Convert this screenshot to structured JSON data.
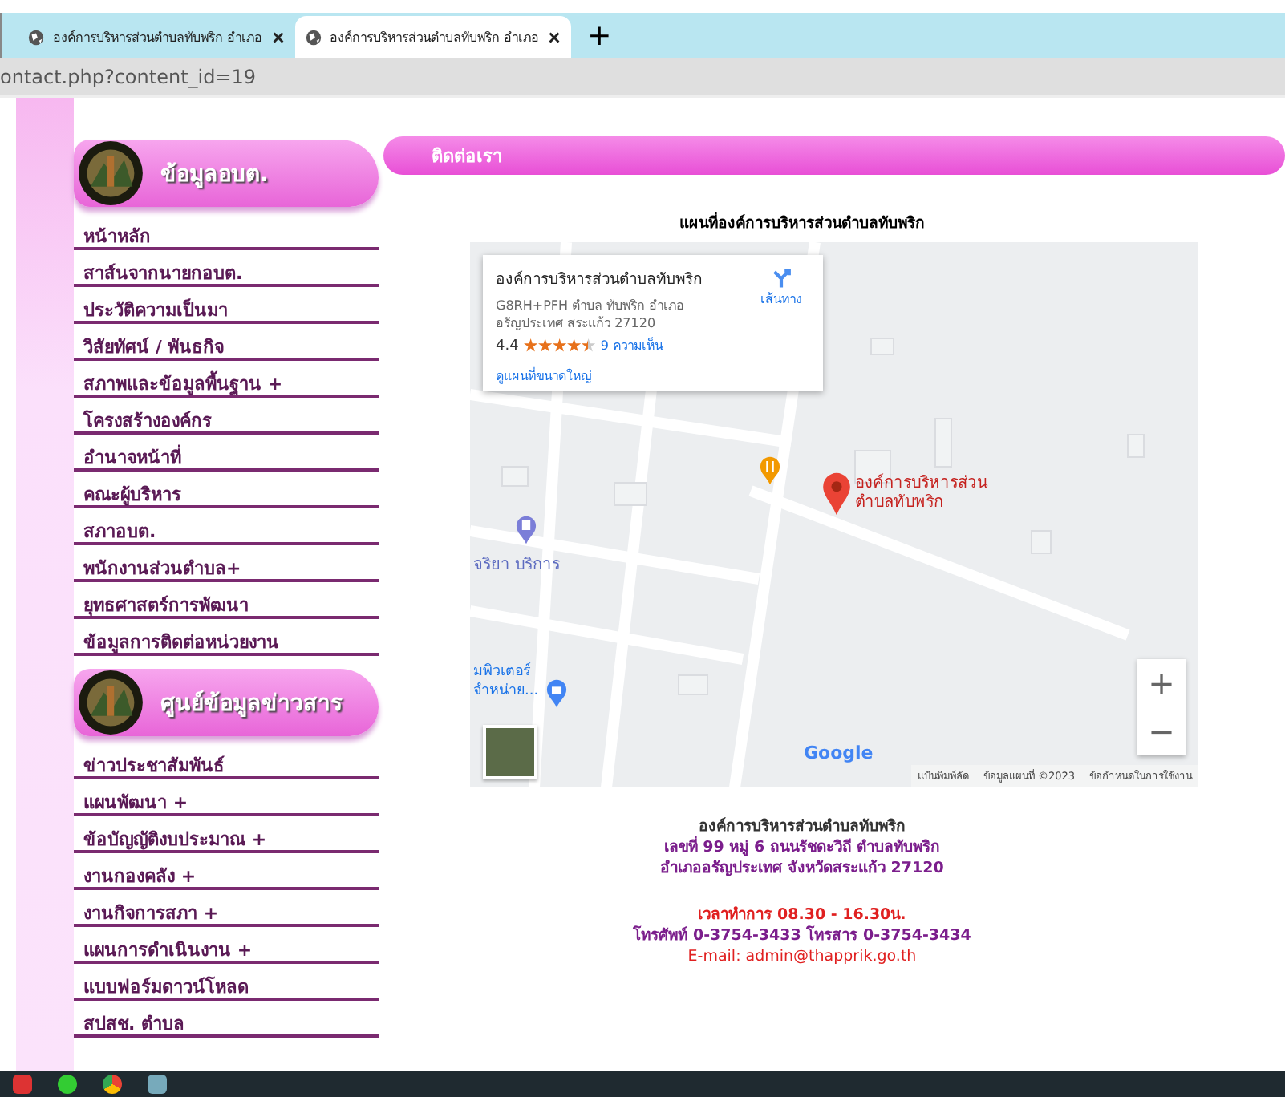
{
  "browser": {
    "tabs": [
      {
        "title": "องค์การบริหารส่วนตำบลทับพริก อำเภอ",
        "selected": false
      },
      {
        "title": "องค์การบริหารส่วนตำบลทับพริก อำเภอ",
        "selected": true
      }
    ],
    "new_tab": "+",
    "address": "ontact.php?content_id=19"
  },
  "sidebar": {
    "sections": [
      {
        "title": "ข้อมูลอบต.",
        "items": [
          "หน้าหลัก",
          "สาส์นจากนายกอบต.",
          "ประวัติความเป็นมา",
          "วิสัยทัศน์ / พันธกิจ",
          "สภาพและข้อมูลพื้นฐาน +",
          "โครงสร้างองค์กร",
          "อำนาจหน้าที่",
          "คณะผู้บริหาร",
          "สภาอบต.",
          "พนักงานส่วนตำบล+",
          "ยุทธศาสตร์การพัฒนา",
          "ข้อมูลการติดต่อหน่วยงาน"
        ]
      },
      {
        "title": "ศูนย์ข้อมูลข่าวสาร",
        "items": [
          "ข่าวประชาสัมพันธ์",
          "แผนพัฒนา +",
          "ข้อบัญญัติงบประมาณ +",
          "งานกองคลัง +",
          "งานกิจการสภา +",
          "แผนการดำเนินงาน +",
          "แบบฟอร์มดาวน์โหลด",
          "สปสช. ตำบล"
        ]
      }
    ]
  },
  "main": {
    "heading": "ติดต่อเรา",
    "map_title": "แผนที่องค์การบริหารส่วนตำบลทับพริก",
    "map": {
      "card": {
        "name": "องค์การบริหารส่วนตำบลทับพริก",
        "address_1": "G8RH+PFH ตำบล ทับพริก อำเภอ",
        "address_2": "อรัญประเทศ สระแก้ว 27120",
        "rating": "4.4",
        "stars": 4.5,
        "reviews": "9 ความเห็น",
        "directions": "เส้นทาง",
        "larger_map": "ดูแผนที่ขนาดใหญ่"
      },
      "marker_label": "องค์การบริหารส่วนตำบลทับพริก",
      "poi_1": "จริยา บริการ",
      "poi_2": "มพิวเตอร์ จำหน่าย...",
      "zoom_in": "+",
      "zoom_out": "−",
      "logo": "Google",
      "attribution": [
        "แป้นพิมพ์ลัด",
        "ข้อมูลแผนที่ ©2023",
        "ข้อกำหนดในการใช้งาน"
      ]
    },
    "contact": {
      "org": "องค์การบริหารส่วนตำบลทับพริก",
      "address_1": "เลขที่ 99 หมู่ 6 ถนนรัชดะวิถี ตำบลทับพริก",
      "address_2": "อำเภออรัญประเทศ จังหวัดสระแก้ว 27120",
      "hours": "เวลาทำการ 08.30 - 16.30น.",
      "phones": "โทรศัพท์ 0-3754-3433  โทรสาร 0-3754-3434",
      "email": "E-mail: admin@thapprik.go.th"
    }
  }
}
